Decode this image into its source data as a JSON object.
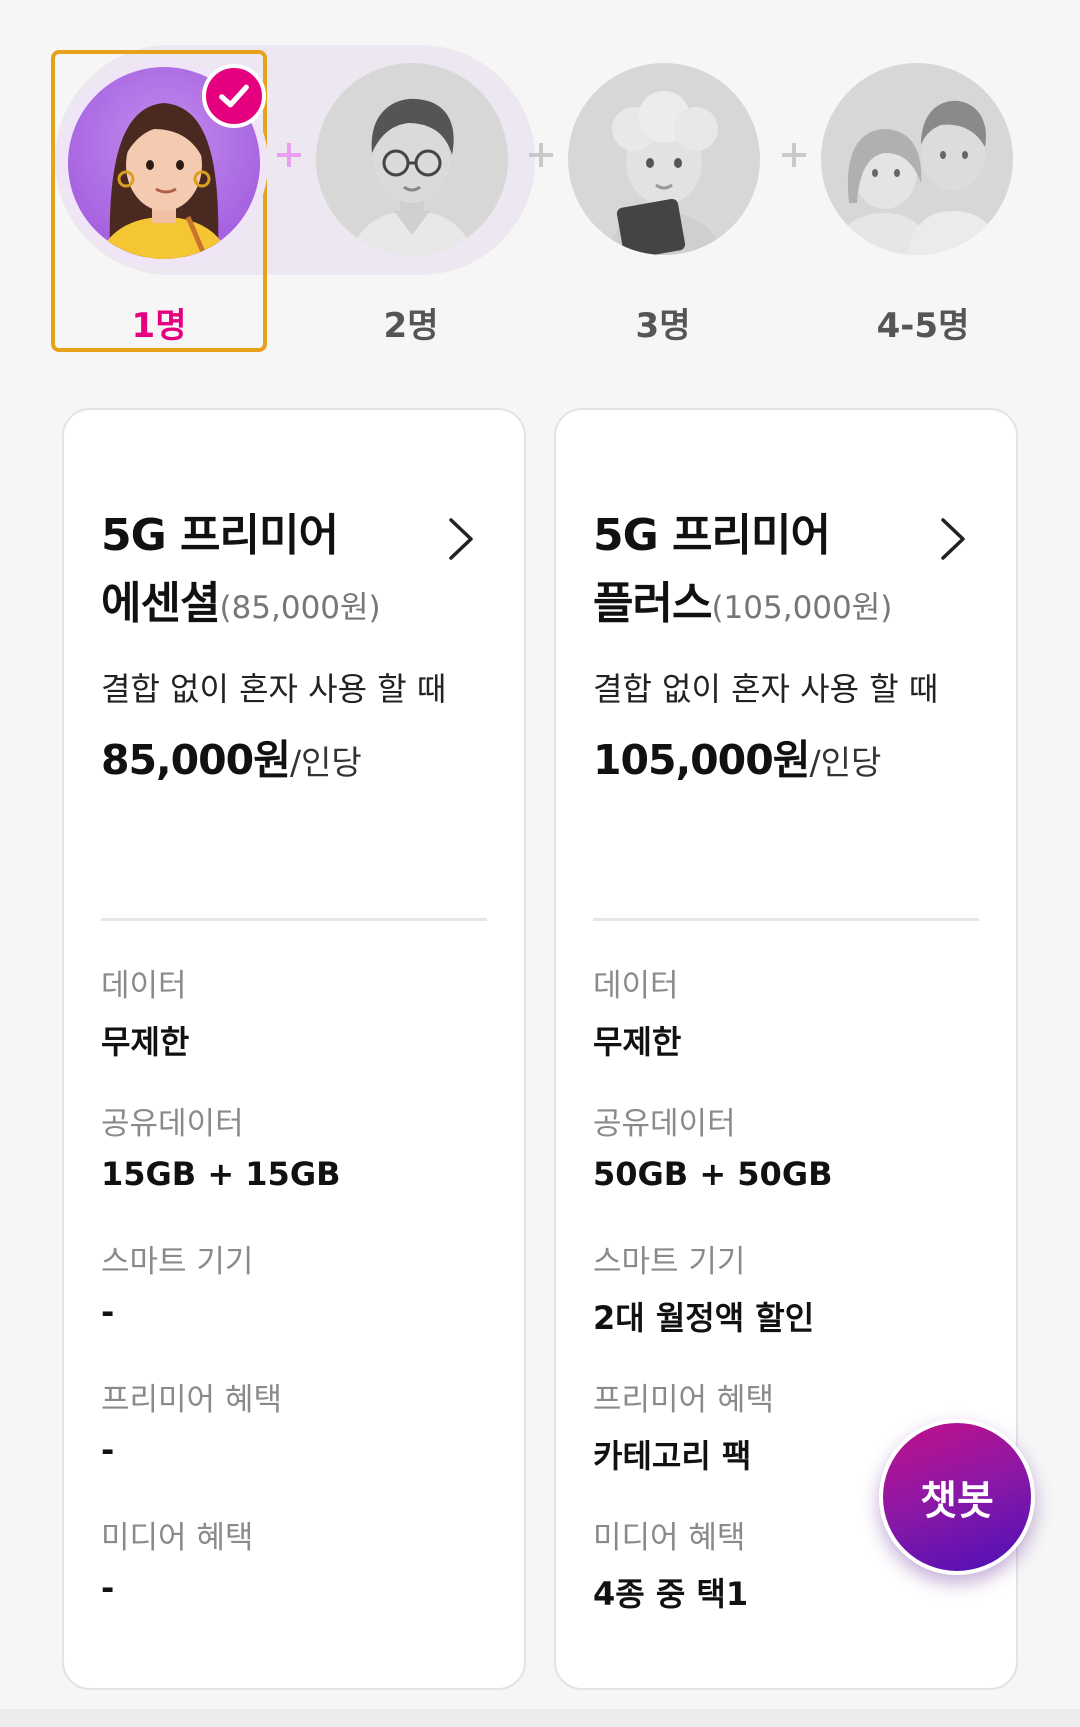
{
  "people_selector": {
    "options": [
      {
        "label": "1명",
        "selected": true
      },
      {
        "label": "2명",
        "selected": false
      },
      {
        "label": "3명",
        "selected": false
      },
      {
        "label": "4-5명",
        "selected": false
      }
    ]
  },
  "plans": [
    {
      "name_line1": "5G 프리미어",
      "name_line2": "에센셜",
      "price_paren": "(85,000원)",
      "desc": "결합 없이 혼자 사용 할 때",
      "price": "85,000원",
      "price_unit": "/인당",
      "features": [
        {
          "label": "데이터",
          "value": "무제한"
        },
        {
          "label": "공유데이터",
          "value": "15GB + 15GB"
        },
        {
          "label": "스마트 기기",
          "value": "-"
        },
        {
          "label": "프리미어 혜택",
          "value": "-"
        },
        {
          "label": "미디어 혜택",
          "value": "-"
        }
      ]
    },
    {
      "name_line1": "5G 프리미어",
      "name_line2": "플러스",
      "price_paren": "(105,000원)",
      "desc": "결합 없이 혼자 사용 할 때",
      "price": "105,000원",
      "price_unit": "/인당",
      "features": [
        {
          "label": "데이터",
          "value": "무제한"
        },
        {
          "label": "공유데이터",
          "value": "50GB + 50GB"
        },
        {
          "label": "스마트 기기",
          "value": "2대 월정액 할인"
        },
        {
          "label": "프리미어 혜택",
          "value": "카테고리 팩"
        },
        {
          "label": "미디어 혜택",
          "value": "4종 중 택1"
        }
      ]
    }
  ],
  "chatbot": {
    "label": "챗봇"
  },
  "colors": {
    "accent": "#e4007f",
    "selection_border": "#e5a21a",
    "chatbot_start": "#c2108a",
    "chatbot_end": "#4b0fb8"
  },
  "icons": {
    "selected_check": "check-icon",
    "plan_link": "chevron-right-icon",
    "separator": "plus-icon"
  }
}
